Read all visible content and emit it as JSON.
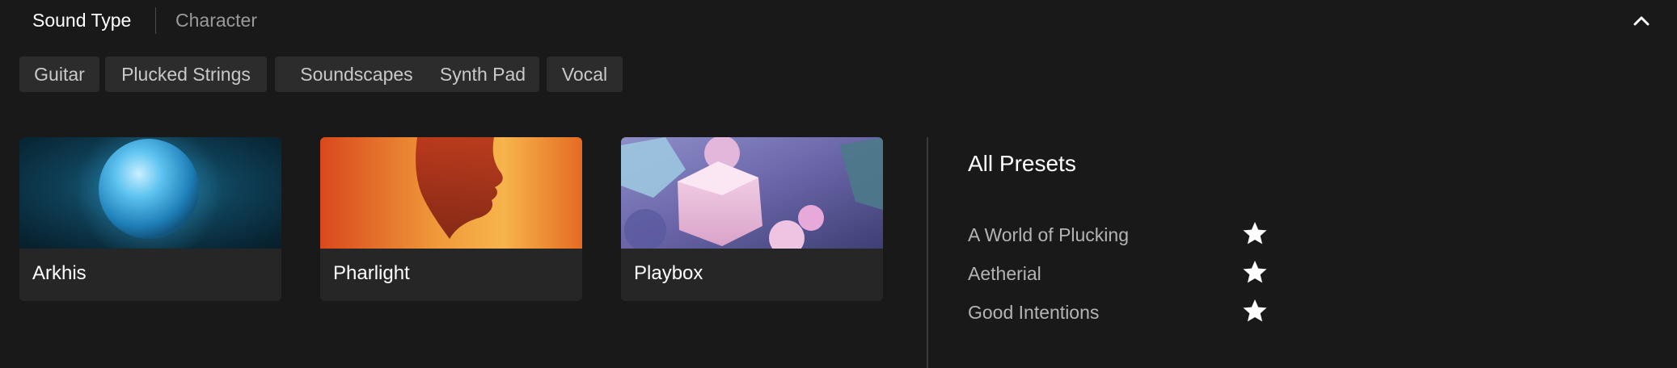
{
  "tabs": {
    "sound_type": "Sound Type",
    "character": "Character",
    "collapse_icon": "chevron-up-icon"
  },
  "chips": [
    "Guitar",
    "Plucked Strings",
    "Soundscapes",
    "Synth Pad",
    "Vocal"
  ],
  "cards": [
    {
      "title": "Arkhis",
      "art": "blue-sphere-artwork"
    },
    {
      "title": "Pharlight",
      "art": "orange-silhouette-artwork"
    },
    {
      "title": "Playbox",
      "art": "pastel-shapes-artwork"
    }
  ],
  "presets": {
    "heading": "All Presets",
    "items": [
      {
        "label": "A World of Plucking",
        "icon": "star-icon"
      },
      {
        "label": "Aetherial",
        "icon": "star-icon"
      },
      {
        "label": "Good Intentions",
        "icon": "star-icon"
      }
    ]
  },
  "colors": {
    "background": "#191919",
    "chip_bg": "#2c2c2c",
    "card_bg": "#262626",
    "text_primary": "#ffffff",
    "text_secondary": "#9a9a9a"
  }
}
